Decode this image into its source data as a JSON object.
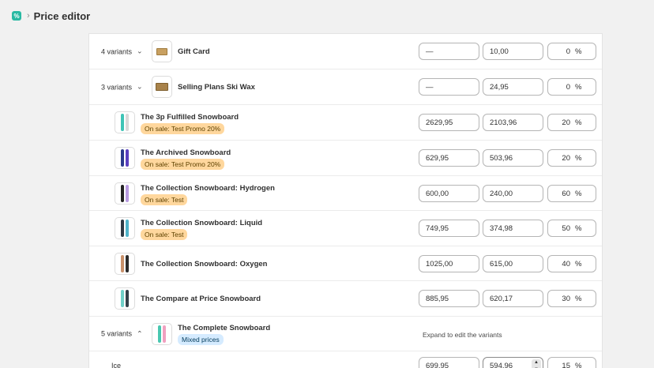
{
  "header": {
    "app_icon_glyph": "%",
    "separator": "›",
    "title": "Price editor"
  },
  "rows": [
    {
      "toggle": "4 variants",
      "chevron": "⌄",
      "name": "Gift Card",
      "thumb": "gift-card",
      "compare": "—",
      "price": "10,00",
      "discount": "0",
      "pct": "%"
    },
    {
      "toggle": "3 variants",
      "chevron": "⌄",
      "name": "Selling Plans Ski Wax",
      "thumb": "wax",
      "compare": "—",
      "price": "24,95",
      "discount": "0",
      "pct": "%"
    },
    {
      "name": "The 3p Fulfilled Snowboard",
      "badge": "On sale: Test Promo 20%",
      "compare": "2629,95",
      "price": "2103,96",
      "discount": "20",
      "pct": "%",
      "colors": [
        "#3fc4b6",
        "#e8e8e8"
      ]
    },
    {
      "name": "The Archived Snowboard",
      "badge": "On sale: Test Promo 20%",
      "compare": "629,95",
      "price": "503,96",
      "discount": "20",
      "pct": "%",
      "colors": [
        "#2b3a8c",
        "#5a3fbf"
      ]
    },
    {
      "name": "The Collection Snowboard: Hydrogen",
      "badge": "On sale: Test",
      "compare": "600,00",
      "price": "240,00",
      "discount": "60",
      "pct": "%",
      "colors": [
        "#222222",
        "#b89be0"
      ]
    },
    {
      "name": "The Collection Snowboard: Liquid",
      "badge": "On sale: Test",
      "compare": "749,95",
      "price": "374,98",
      "discount": "50",
      "pct": "%",
      "colors": [
        "#2e3a44",
        "#4fb3c9"
      ]
    },
    {
      "name": "The Collection Snowboard: Oxygen",
      "compare": "1025,00",
      "price": "615,00",
      "discount": "40",
      "pct": "%",
      "colors": [
        "#c8906a",
        "#2a2a2a"
      ]
    },
    {
      "name": "The Compare at Price Snowboard",
      "compare": "885,95",
      "price": "620,17",
      "discount": "30",
      "pct": "%",
      "colors": [
        "#6fd0c8",
        "#333f48"
      ]
    },
    {
      "toggle": "5 variants",
      "chevron": "⌃",
      "name": "The Complete Snowboard",
      "badge": "Mixed prices",
      "hint": "Expand to edit the variants",
      "colors": [
        "#48c7b0",
        "#f0a0c0"
      ]
    },
    {
      "variant": "Ice",
      "compare": "699,95",
      "price": "594,96",
      "discount": "15",
      "pct": "%",
      "stepper_up": "▲",
      "stepper_down": "▼"
    }
  ]
}
